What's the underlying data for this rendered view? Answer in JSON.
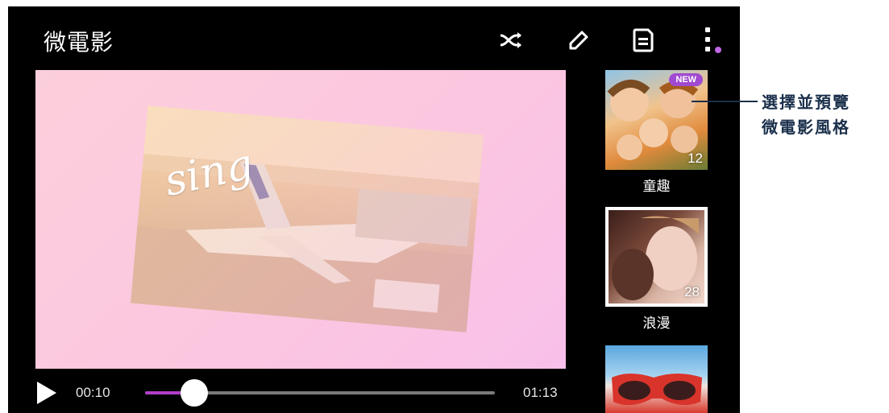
{
  "app": {
    "title": "微電影"
  },
  "toolbar": {
    "icons": [
      "shuffle-icon",
      "pencil-icon",
      "save-icon",
      "more-vert-icon"
    ],
    "accent_color": "#b13ec9"
  },
  "preview": {
    "overlay_text": "sing"
  },
  "player": {
    "current_time": "00:10",
    "total_time": "01:13",
    "progress_fraction": 0.14
  },
  "themes": [
    {
      "label": "童趣",
      "count": "12",
      "badge": "NEW",
      "selected": false
    },
    {
      "label": "浪漫",
      "count": "28",
      "selected": true
    },
    {
      "label": "",
      "count": "",
      "selected": false
    }
  ],
  "callout": {
    "line1": "選擇並預覽",
    "line2": "微電影風格"
  }
}
